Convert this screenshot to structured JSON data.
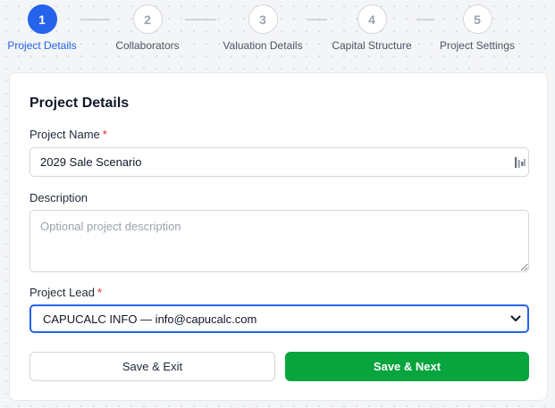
{
  "stepper": {
    "active_index": 0,
    "steps": [
      {
        "number": "1",
        "label": "Project Details"
      },
      {
        "number": "2",
        "label": "Collaborators"
      },
      {
        "number": "3",
        "label": "Valuation Details"
      },
      {
        "number": "4",
        "label": "Capital Structure"
      },
      {
        "number": "5",
        "label": "Project Settings"
      }
    ]
  },
  "form": {
    "title": "Project Details",
    "project_name": {
      "label": "Project Name",
      "required_mark": "*",
      "value": "2029 Sale Scenario",
      "icon": "autofill-icon"
    },
    "description": {
      "label": "Description",
      "value": "",
      "placeholder": "Optional project description"
    },
    "project_lead": {
      "label": "Project Lead",
      "required_mark": "*",
      "selected": "CAPUCALC INFO — info@capucalc.com",
      "icon": "chevron-down-icon"
    }
  },
  "actions": {
    "save_exit": "Save & Exit",
    "save_next": "Save & Next"
  },
  "colors": {
    "accent": "#2563eb",
    "primary_button": "#08a43e",
    "required": "#dc2626"
  }
}
